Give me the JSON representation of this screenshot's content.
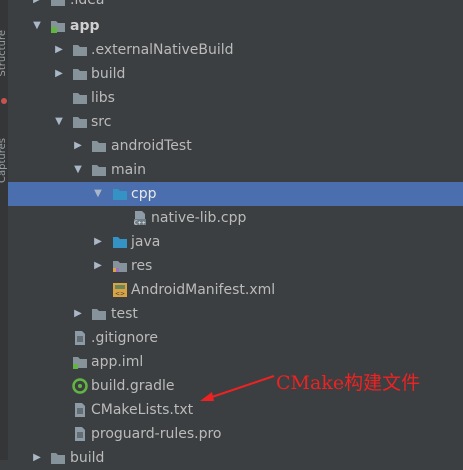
{
  "gutter": {
    "tab_top": "Structure",
    "tab_bottom": "Captures"
  },
  "tree": {
    "idea": ".idea",
    "app": "app",
    "externalNativeBuild": ".externalNativeBuild",
    "build_app": "build",
    "libs": "libs",
    "src": "src",
    "androidTest": "androidTest",
    "main": "main",
    "cpp": "cpp",
    "native_lib": "native-lib.cpp",
    "java": "java",
    "res": "res",
    "manifest": "AndroidManifest.xml",
    "test": "test",
    "gitignore": ".gitignore",
    "app_iml": "app.iml",
    "build_gradle": "build.gradle",
    "cmakelists": "CMakeLists.txt",
    "proguard": "proguard-rules.pro",
    "build_root": "build"
  },
  "annotation": {
    "text": "CMake构建文件",
    "color": "#ee2222"
  },
  "colors": {
    "background": "#3c3f41",
    "selection": "#4b6eaf",
    "folder": "#87939a",
    "source_folder": "#3592c4"
  }
}
